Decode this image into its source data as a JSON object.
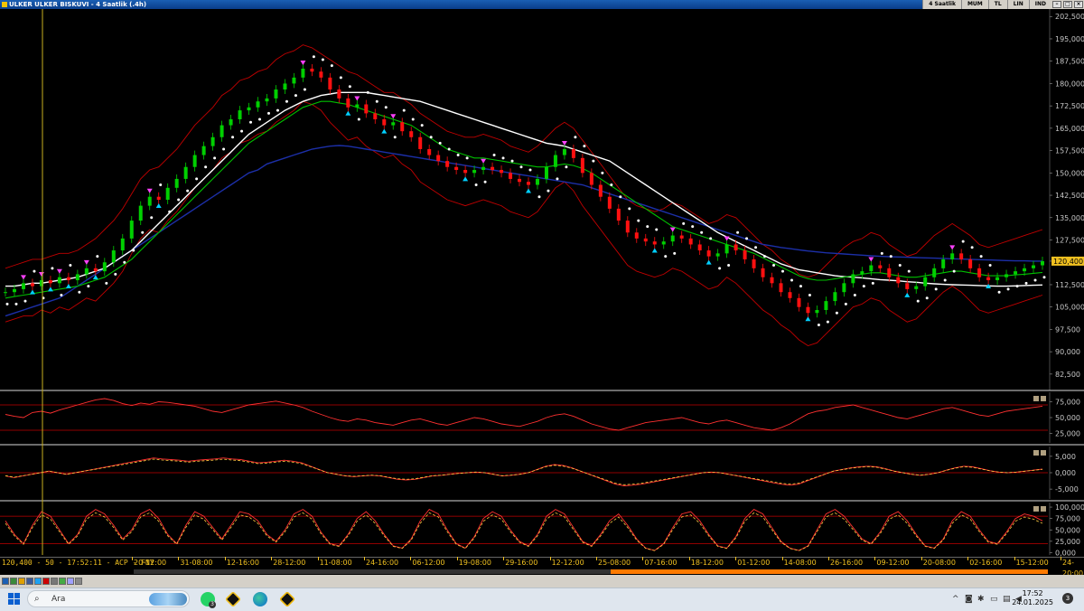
{
  "window": {
    "title": "ULKER ULKER BISKUVI - 4 Saatlik (.4h)",
    "toolbar_items": [
      "4 Saatlik",
      "MUM",
      "TL",
      "LIN",
      "IND"
    ]
  },
  "status": {
    "readout": "120,400 - 50 - 17:52:11 - ACP - FNY"
  },
  "taskbar": {
    "search_placeholder": "Ara",
    "whatsapp_badge": "3",
    "notification_count": "3",
    "time": "17:52",
    "date": "24.01.2025"
  },
  "colors": {
    "accent": "#f0c020",
    "candle_up": "#00d000",
    "candle_down": "#ff1010",
    "band": "#c00000",
    "ma_long": "#1c2fa8",
    "ma_slow": "#ffffff",
    "ma_mid": "#00c000",
    "sar": "#ffffff",
    "signal_up": "#00d0ff",
    "signal_down": "#ff40ff",
    "osc_line": "#ff3030",
    "level_line": "#c00000"
  },
  "chart_data": [
    {
      "type": "line",
      "name": "price",
      "y_ticks": [
        "202,500",
        "195,000",
        "187,500",
        "180,000",
        "172,500",
        "165,000",
        "157,500",
        "150,000",
        "142,500",
        "135,000",
        "127,500",
        "120,400",
        "112,500",
        "105,000",
        "97,500",
        "90,000",
        "82,500"
      ],
      "ylim": [
        77.0,
        205.0
      ],
      "current": "120,400",
      "x_ticks": [
        "20-12:00",
        "31-08:00",
        "12-16:00",
        "28-12:00",
        "11-08:00",
        "24-16:00",
        "06-12:00",
        "19-08:00",
        "29-16:00",
        "12-12:00",
        "25-08:00",
        "07-16:00",
        "18-12:00",
        "01-12:00",
        "14-08:00",
        "26-16:00",
        "09-12:00",
        "20-08:00",
        "02-16:00",
        "15-12:00",
        "24-20:00"
      ],
      "close": [
        110,
        111,
        113,
        112,
        114,
        113,
        115,
        114,
        116,
        118,
        117,
        120,
        124,
        128,
        134,
        139,
        142,
        141,
        145,
        148,
        152,
        156,
        159,
        162,
        166,
        168,
        171,
        172,
        174,
        175,
        178,
        180,
        182,
        185,
        184,
        182,
        178,
        175,
        172,
        173,
        170,
        168,
        166,
        167,
        164,
        162,
        158,
        156,
        154,
        152,
        151,
        150,
        151,
        152,
        151,
        150,
        148,
        147,
        146,
        148,
        152,
        156,
        158,
        155,
        150,
        146,
        142,
        138,
        134,
        130,
        128,
        127,
        126,
        127,
        129,
        128,
        126,
        124,
        122,
        123,
        126,
        124,
        121,
        118,
        115,
        113,
        110,
        108,
        105,
        103,
        104,
        107,
        110,
        113,
        116,
        117,
        119,
        118,
        115,
        113,
        111,
        112,
        115,
        118,
        121,
        123,
        121,
        118,
        115,
        114,
        115,
        116,
        117,
        118,
        119,
        120.4
      ],
      "ma_long": [
        102,
        103,
        104,
        105,
        106,
        107,
        108,
        110,
        112,
        114,
        116,
        118,
        120,
        122,
        124,
        126,
        128,
        130,
        132,
        134,
        136,
        138,
        140,
        142,
        144,
        146,
        148,
        150,
        151,
        153,
        154,
        155,
        156,
        157,
        158,
        158.5,
        159,
        159.2,
        159,
        158.5,
        158,
        157.5,
        157,
        156.5,
        156,
        155.5,
        155,
        154.5,
        154,
        153.5,
        153,
        152.5,
        152,
        151.5,
        151,
        150.5,
        150,
        149.5,
        149,
        148.5,
        148,
        147.5,
        147,
        146.5,
        146,
        145,
        144,
        143,
        142,
        141,
        140,
        139,
        138,
        137,
        136,
        135,
        134,
        133,
        132,
        131,
        130,
        129,
        128,
        127,
        126,
        125.5,
        125,
        124.6,
        124.2,
        123.8,
        123.5,
        123.2,
        123,
        122.8,
        122.6,
        122.4,
        122.2,
        122,
        121.9,
        121.8,
        121.7,
        121.6,
        121.5,
        121.4,
        121.3,
        121.2,
        121.1,
        121,
        120.9,
        120.8,
        120.7,
        120.6,
        120.5,
        120.5,
        120.4,
        120.4
      ],
      "ma_slow": [
        112,
        112,
        112.5,
        113,
        113,
        113.5,
        114,
        114.5,
        115,
        116,
        117,
        118,
        120,
        122,
        124,
        127,
        130,
        133,
        136,
        139,
        142,
        145,
        148,
        151,
        154,
        157,
        160,
        163,
        165,
        167,
        169,
        171,
        172.5,
        174,
        175,
        176,
        176.5,
        177,
        177,
        177,
        177,
        176.5,
        176,
        175.5,
        175,
        174.5,
        174,
        173,
        172,
        171,
        170,
        169,
        168,
        167,
        166,
        165,
        164,
        163,
        162,
        161,
        160,
        159.5,
        159,
        158,
        157,
        156,
        155,
        154,
        152,
        150,
        148,
        146,
        144,
        142,
        140,
        138,
        136,
        134,
        132,
        130,
        128.5,
        127,
        125.5,
        124,
        122.5,
        121,
        119.5,
        118.5,
        117.5,
        117,
        116.5,
        116,
        115.5,
        115.2,
        115,
        114.8,
        114.5,
        114.2,
        114,
        113.8,
        113.5,
        113.3,
        113,
        112.8,
        112.6,
        112.5,
        112.4,
        112.3,
        112.2,
        112.1,
        112,
        112,
        112.1,
        112.2,
        112.3,
        112.4
      ],
      "ma_mid": [
        108,
        108.5,
        109,
        109.5,
        110,
        110.5,
        111,
        111.5,
        112,
        113,
        114,
        115,
        117,
        119,
        121,
        124,
        127,
        130,
        133,
        136,
        139,
        142,
        145,
        148,
        151,
        154,
        157,
        160,
        162,
        164,
        166,
        168,
        170,
        172,
        173,
        174,
        174,
        173.5,
        173,
        172,
        171,
        170,
        169,
        168,
        167,
        166,
        164,
        162,
        160,
        158,
        157,
        156,
        155,
        155,
        154.5,
        154,
        153.5,
        153,
        152.5,
        152,
        152,
        152.5,
        153,
        152.5,
        151.5,
        150,
        148,
        146,
        144,
        142,
        140,
        138,
        136,
        134,
        132,
        131,
        130,
        129,
        128,
        127,
        126,
        125,
        124,
        123,
        121.5,
        120,
        118.5,
        117,
        115.5,
        114.5,
        114,
        114,
        114.5,
        115,
        115.5,
        116,
        116.5,
        116.5,
        116,
        115.5,
        115,
        115,
        115.5,
        116,
        116.5,
        117,
        117,
        116.5,
        116,
        115.5,
        115.5,
        115.5,
        115.8,
        116,
        116.3,
        116.6
      ],
      "band_upper": [
        118,
        119,
        120,
        121,
        121,
        122,
        123,
        123,
        124,
        126,
        128,
        131,
        134,
        138,
        143,
        148,
        151,
        152,
        155,
        158,
        162,
        166,
        169,
        172,
        176,
        178,
        181,
        182,
        184,
        185,
        188,
        190,
        191,
        193,
        192,
        190,
        188,
        186,
        184,
        183,
        181,
        179,
        177,
        177,
        175,
        173,
        170,
        168,
        166,
        164,
        163,
        162,
        162,
        163,
        162,
        161,
        159,
        158,
        157,
        159,
        162,
        165,
        167,
        165,
        161,
        157,
        153,
        149,
        145,
        141,
        139,
        138,
        137,
        138,
        140,
        139,
        137,
        135,
        133,
        134,
        136,
        135,
        132,
        129,
        126,
        124,
        121,
        119,
        116,
        115,
        116,
        119,
        122,
        125,
        127,
        128,
        130,
        129,
        126,
        124,
        122,
        123,
        126,
        129,
        131,
        133,
        131,
        129,
        126,
        125,
        126,
        127,
        128,
        129,
        130,
        131
      ],
      "band_lower": [
        100,
        101,
        102,
        102,
        104,
        103,
        105,
        104,
        106,
        108,
        107,
        110,
        113,
        117,
        123,
        128,
        131,
        130,
        134,
        137,
        141,
        145,
        148,
        151,
        155,
        157,
        160,
        161,
        163,
        164,
        167,
        169,
        171,
        174,
        173,
        171,
        167,
        164,
        161,
        162,
        159,
        157,
        155,
        156,
        153,
        151,
        147,
        145,
        143,
        141,
        140,
        139,
        140,
        141,
        140,
        139,
        137,
        136,
        135,
        137,
        141,
        145,
        147,
        144,
        139,
        135,
        131,
        127,
        123,
        119,
        117,
        116,
        115,
        116,
        118,
        117,
        115,
        113,
        111,
        112,
        115,
        113,
        110,
        107,
        104,
        102,
        99,
        97,
        94,
        92,
        93,
        96,
        99,
        102,
        105,
        106,
        108,
        107,
        104,
        102,
        100,
        101,
        104,
        107,
        110,
        112,
        110,
        107,
        104,
        103,
        104,
        105,
        106,
        107,
        108,
        109
      ]
    },
    {
      "type": "line",
      "name": "oscillator-1",
      "y_ticks": [
        "75,000",
        "50,000",
        "25,000"
      ],
      "ylim": [
        10,
        90
      ],
      "levels": [
        70,
        30
      ],
      "values": [
        55,
        52,
        50,
        58,
        60,
        57,
        62,
        66,
        70,
        74,
        78,
        80,
        77,
        72,
        69,
        73,
        71,
        75,
        74,
        72,
        70,
        68,
        64,
        60,
        58,
        62,
        66,
        70,
        72,
        74,
        76,
        73,
        70,
        66,
        60,
        55,
        50,
        46,
        44,
        48,
        46,
        42,
        40,
        38,
        42,
        46,
        48,
        44,
        40,
        38,
        42,
        46,
        50,
        48,
        44,
        40,
        38,
        36,
        40,
        44,
        50,
        54,
        56,
        52,
        46,
        40,
        36,
        32,
        30,
        34,
        38,
        42,
        44,
        46,
        48,
        50,
        46,
        42,
        40,
        44,
        46,
        42,
        38,
        34,
        32,
        30,
        34,
        40,
        48,
        56,
        60,
        62,
        66,
        68,
        70,
        66,
        62,
        58,
        54,
        50,
        48,
        52,
        56,
        60,
        64,
        66,
        62,
        58,
        54,
        52,
        56,
        60,
        62,
        64,
        66,
        68
      ]
    },
    {
      "type": "line",
      "name": "oscillator-2",
      "y_ticks": [
        "5,000",
        "0,000",
        "-5,000"
      ],
      "ylim": [
        -8,
        8
      ],
      "levels": [
        0
      ],
      "values": [
        -1,
        -1.5,
        -1,
        -0.5,
        0,
        0.5,
        0,
        -0.5,
        0,
        0.5,
        1,
        1.5,
        2,
        2.5,
        3,
        3.5,
        4,
        4.5,
        4.2,
        4,
        3.8,
        3.5,
        3.8,
        4,
        4.2,
        4.5,
        4.2,
        4,
        3.5,
        3,
        3.2,
        3.5,
        3.8,
        3.5,
        3,
        2,
        1,
        0,
        -0.5,
        -1,
        -1.2,
        -1,
        -0.8,
        -1,
        -1.5,
        -2,
        -2.2,
        -2,
        -1.5,
        -1,
        -0.8,
        -0.5,
        -0.2,
        0,
        0.2,
        0,
        -0.5,
        -1,
        -0.8,
        -0.5,
        0,
        1,
        2,
        2.5,
        2.2,
        1.5,
        0.5,
        -0.5,
        -1.5,
        -2.5,
        -3.5,
        -4,
        -3.8,
        -3.5,
        -3,
        -2.5,
        -2,
        -1.5,
        -1,
        -0.5,
        0,
        0.2,
        0,
        -0.5,
        -1,
        -1.5,
        -2,
        -2.5,
        -3,
        -3.5,
        -3.8,
        -3.5,
        -2.5,
        -1.5,
        -0.5,
        0.5,
        1,
        1.5,
        1.8,
        2,
        1.8,
        1.2,
        0.5,
        0,
        -0.5,
        -0.8,
        -0.5,
        0,
        0.8,
        1.5,
        2,
        1.8,
        1.2,
        0.6,
        0.2,
        0,
        0.2,
        0.5,
        0.8,
        1.1
      ]
    },
    {
      "type": "line",
      "name": "oscillator-3",
      "y_ticks": [
        "100,000",
        "75,000",
        "50,000",
        "25,000",
        "0,000"
      ],
      "ylim": [
        -5,
        110
      ],
      "levels": [
        80,
        20
      ],
      "values": [
        70,
        40,
        20,
        60,
        90,
        80,
        50,
        20,
        40,
        80,
        95,
        85,
        60,
        30,
        50,
        85,
        95,
        75,
        40,
        20,
        60,
        90,
        80,
        55,
        30,
        60,
        90,
        85,
        70,
        40,
        25,
        50,
        85,
        95,
        80,
        45,
        20,
        15,
        40,
        75,
        90,
        70,
        40,
        15,
        10,
        30,
        70,
        95,
        85,
        50,
        20,
        10,
        35,
        75,
        90,
        80,
        50,
        25,
        15,
        40,
        80,
        95,
        85,
        55,
        25,
        15,
        40,
        70,
        85,
        60,
        30,
        10,
        5,
        20,
        55,
        85,
        90,
        70,
        40,
        15,
        10,
        35,
        75,
        95,
        85,
        55,
        25,
        10,
        5,
        15,
        50,
        85,
        95,
        80,
        55,
        30,
        20,
        45,
        80,
        90,
        70,
        40,
        15,
        10,
        30,
        70,
        90,
        80,
        50,
        25,
        20,
        45,
        75,
        85,
        80,
        70
      ]
    }
  ]
}
